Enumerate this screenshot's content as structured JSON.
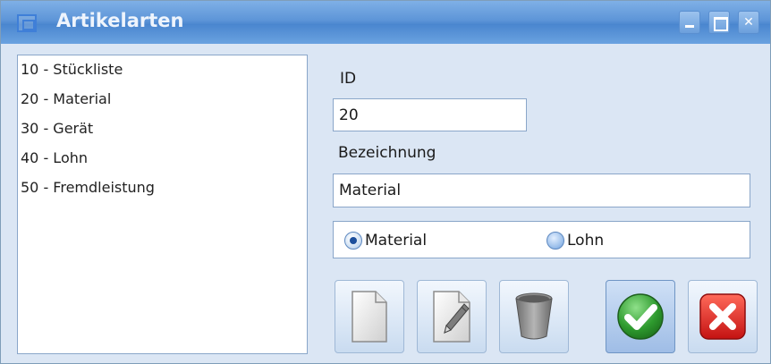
{
  "window": {
    "title": "Artikelarten"
  },
  "list": {
    "items": [
      "10 - Stückliste",
      "20 - Material",
      "30 - Gerät",
      "40 - Lohn",
      "50 - Fremdleistung"
    ]
  },
  "form": {
    "id_label": "ID",
    "id_value": "20",
    "bezeichnung_label": "Bezeichnung",
    "bezeichnung_value": "Material",
    "radio_options": [
      "Material",
      "Lohn"
    ],
    "radio_selected": "Material"
  },
  "toolbar": {
    "icons": [
      "new-document-icon",
      "edit-pencil-icon",
      "trash-bin-icon",
      "checkmark-icon",
      "cancel-x-icon"
    ]
  },
  "colors": {
    "titlebar": "#5d95d8",
    "accept": "#2e9a2e",
    "cancel": "#d42020"
  }
}
